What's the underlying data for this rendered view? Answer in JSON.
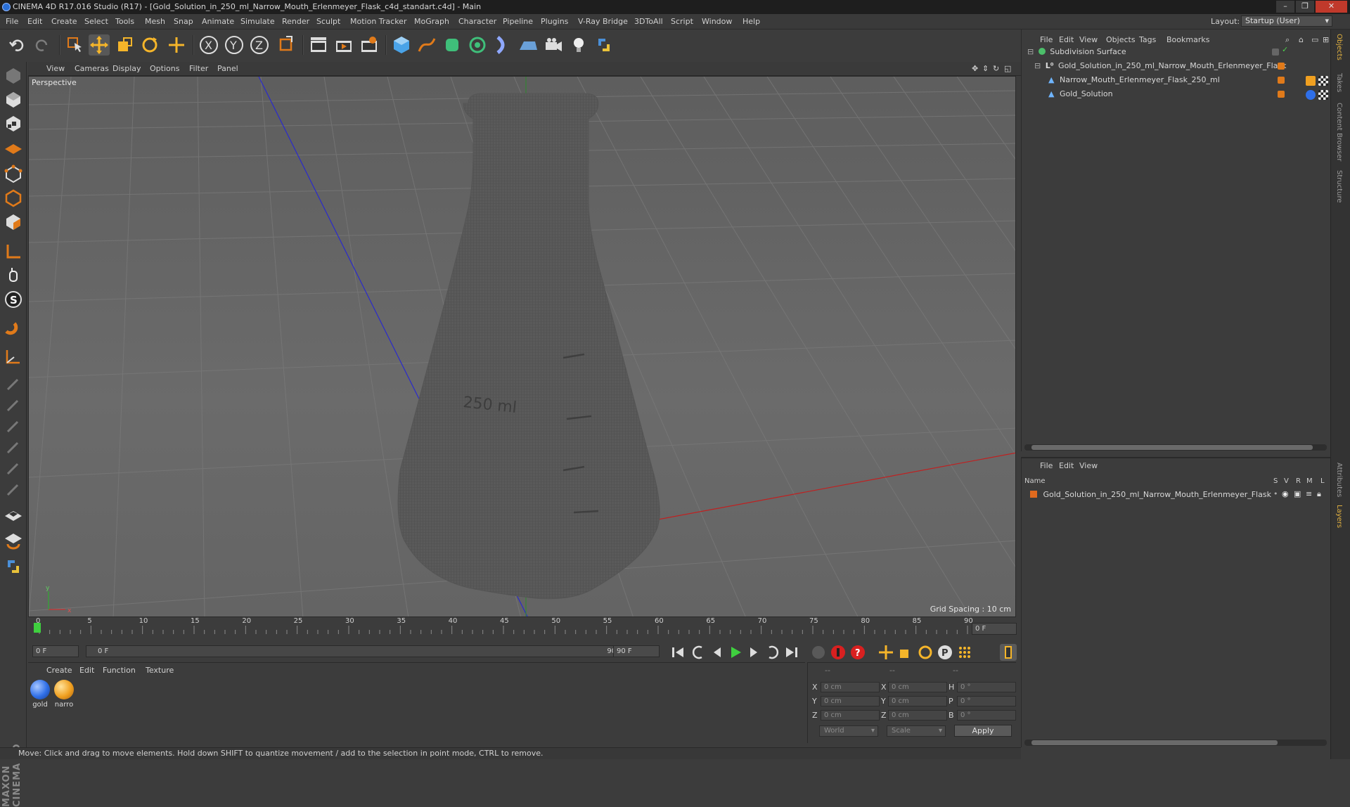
{
  "window": {
    "title": "CINEMA 4D R17.016 Studio (R17) - [Gold_Solution_in_250_ml_Narrow_Mouth_Erlenmeyer_Flask_c4d_standart.c4d] - Main",
    "controls": [
      "–",
      "❐",
      "✕"
    ]
  },
  "menu": [
    "File",
    "Edit",
    "Create",
    "Select",
    "Tools",
    "Mesh",
    "Snap",
    "Animate",
    "Simulate",
    "Render",
    "Sculpt",
    "Motion Tracker",
    "MoGraph",
    "Character",
    "Pipeline",
    "Plugins",
    "V-Ray Bridge",
    "3DToAll",
    "Script",
    "Window",
    "Help"
  ],
  "layout": {
    "label": "Layout:",
    "value": "Startup (User)"
  },
  "viewport": {
    "menu": [
      "View",
      "Cameras",
      "Display",
      "Options",
      "Filter",
      "Panel"
    ],
    "label": "Perspective",
    "grid_spacing": "Grid Spacing : 10 cm",
    "flask_marks": [
      "250 ml"
    ]
  },
  "timeline": {
    "ticks": [
      "0",
      "5",
      "10",
      "15",
      "20",
      "25",
      "30",
      "35",
      "40",
      "45",
      "50",
      "55",
      "60",
      "65",
      "70",
      "75",
      "80",
      "85",
      "90"
    ],
    "current_frame": "0 F",
    "start_field": "0 F",
    "range_start": "0 F",
    "range_end": "90 F",
    "end_field": "90 F"
  },
  "materials": {
    "menu": [
      "Create",
      "Edit",
      "Function",
      "Texture"
    ],
    "items": [
      {
        "name": "gold",
        "color": "#2f6fe8"
      },
      {
        "name": "narro",
        "color": "#f0a020"
      }
    ]
  },
  "coordinates": {
    "headers": [
      "--",
      "--",
      "--"
    ],
    "rows": [
      {
        "a": "X",
        "av": "0 cm",
        "b": "X",
        "bv": "0 cm",
        "c": "H",
        "cv": "0 °"
      },
      {
        "a": "Y",
        "av": "0 cm",
        "b": "Y",
        "bv": "0 cm",
        "c": "P",
        "cv": "0 °"
      },
      {
        "a": "Z",
        "av": "0 cm",
        "b": "Z",
        "bv": "0 cm",
        "c": "B",
        "cv": "0 °"
      }
    ],
    "mode": "World",
    "scale": "Scale",
    "apply": "Apply"
  },
  "object_manager": {
    "menu": [
      "File",
      "Edit",
      "View",
      "Objects",
      "Tags",
      "Bookmarks"
    ],
    "objects": [
      {
        "name": "Subdivision Surface",
        "icon": "subdivision-icon"
      },
      {
        "name": "Gold_Solution_in_250_ml_Narrow_Mouth_Erlenmeyer_Flask",
        "icon": "null-icon"
      },
      {
        "name": "Narrow_Mouth_Erlenmeyer_Flask_250_ml",
        "icon": "polygon-icon"
      },
      {
        "name": "Gold_Solution",
        "icon": "polygon-icon"
      }
    ]
  },
  "layer_manager": {
    "menu": [
      "File",
      "Edit",
      "View"
    ],
    "columns": [
      "Name",
      "S",
      "V",
      "R",
      "M",
      "L"
    ],
    "layers": [
      {
        "name": "Gold_Solution_in_250_ml_Narrow_Mouth_Erlenmeyer_Flask",
        "color": "#e06a1e"
      }
    ]
  },
  "right_tabs": [
    "Objects",
    "Takes",
    "Content Browser",
    "Structure",
    "Attributes",
    "Layers"
  ],
  "status": "Move: Click and drag to move elements. Hold down SHIFT to quantize movement / add to the selection in point mode, CTRL to remove.",
  "colors": {
    "accent_orange": "#e07a1a",
    "accent_blue": "#2f6fe8",
    "play_green": "#3fd03f",
    "record_red": "#d82020"
  }
}
